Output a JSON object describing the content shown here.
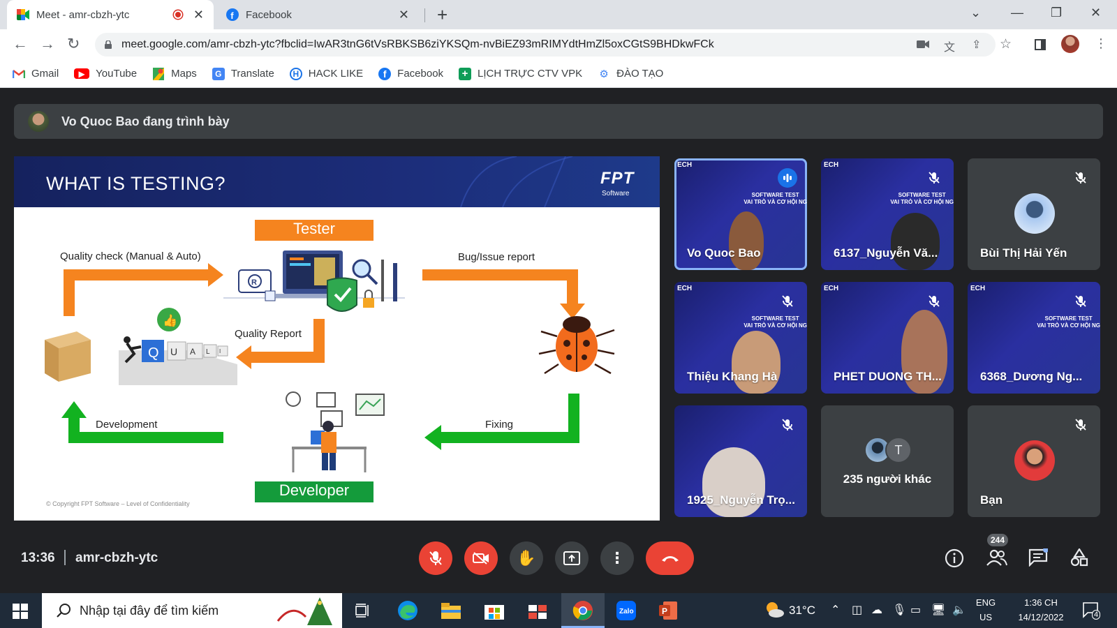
{
  "browser": {
    "tabs": [
      {
        "title": "Meet - amr-cbzh-ytc",
        "favicon": "google-meet-icon",
        "recording": true
      },
      {
        "title": "Facebook",
        "favicon": "facebook-icon"
      }
    ],
    "url": "meet.google.com/amr-cbzh-ytc?fbclid=IwAR3tnG6tVsRBKSB6ziYKSQm-nvBiEZ93mRIMYdtHmZl5oxCGtS9BHDkwFCk",
    "bookmarks": [
      {
        "label": "Gmail",
        "icon": "gmail-icon",
        "color": "#ea4335"
      },
      {
        "label": "YouTube",
        "icon": "youtube-icon",
        "color": "#ff0000"
      },
      {
        "label": "Maps",
        "icon": "maps-icon",
        "color": "#34a853"
      },
      {
        "label": "Translate",
        "icon": "translate-icon",
        "color": "#4285f4"
      },
      {
        "label": "HACK LIKE",
        "icon": "hacklike-icon",
        "color": "#1a73e8"
      },
      {
        "label": "Facebook",
        "icon": "facebook-icon",
        "color": "#1877f2"
      },
      {
        "label": "LỊCH TRỰC CTV VPK",
        "icon": "sheets-icon",
        "color": "#0f9d58"
      },
      {
        "label": "ĐÀO TẠO",
        "icon": "training-icon",
        "color": "#4285f4"
      }
    ]
  },
  "meet": {
    "presenting_text": "Vo Quoc Bao đang trình bày",
    "slide": {
      "title": "WHAT IS TESTING?",
      "brand": "FPT",
      "brand_sub": "Software",
      "tester": "Tester",
      "developer": "Developer",
      "quality_check": "Quality check (Manual & Auto)",
      "bug_report": "Bug/Issue report",
      "quality_report": "Quality Report",
      "development": "Development",
      "fixing": "Fixing",
      "quality_word": "QUALITY",
      "copyright": "© Copyright FPT Software – Level of Confidentiality"
    },
    "participants": [
      {
        "name": "Vo Quoc Bao",
        "mic": "speaking",
        "type": "video"
      },
      {
        "name": "6137_Nguyễn Vă...",
        "mic": "muted",
        "type": "video"
      },
      {
        "name": "Bùi Thị Hải Yến",
        "mic": "muted",
        "type": "avatar"
      },
      {
        "name": "Thiệu Khang Hà",
        "mic": "muted",
        "type": "video"
      },
      {
        "name": "PHET DUONG TH...",
        "mic": "muted",
        "type": "video"
      },
      {
        "name": "6368_Dương Ng...",
        "mic": "muted",
        "type": "video"
      },
      {
        "name": "1925_Nguyễn Trọ...",
        "mic": "muted",
        "type": "video"
      },
      {
        "name": "235 người khác",
        "mic": "none",
        "type": "group",
        "initial": "T"
      },
      {
        "name": "Bạn",
        "mic": "muted",
        "type": "avatar"
      }
    ],
    "video_banner": {
      "tech": "ECH",
      "line1": "SOFTWARE TEST",
      "line2": "VAI TRÒ VÀ CƠ HỘI NG"
    },
    "time": "13:36",
    "meeting_code": "amr-cbzh-ytc",
    "participant_count": "244",
    "controls": [
      "mic-off",
      "camera-off",
      "raise-hand",
      "present",
      "more-options",
      "leave-call"
    ],
    "colors": {
      "danger": "#ea4335",
      "control_bg": "#3c4043",
      "accent": "#8ab4f8"
    }
  },
  "taskbar": {
    "search_placeholder": "Nhập tại đây để tìm kiếm",
    "weather": "31°C",
    "lang_top": "ENG",
    "lang_bottom": "US",
    "time": "1:36 CH",
    "date": "14/12/2022",
    "notifications": "4"
  }
}
